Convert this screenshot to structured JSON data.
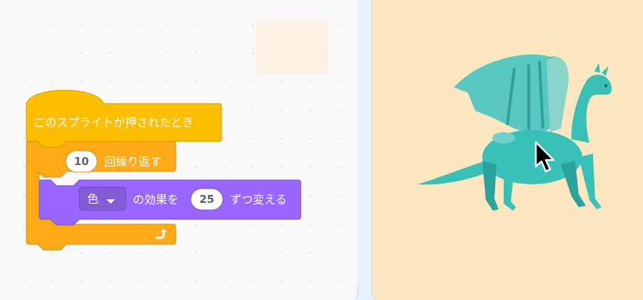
{
  "event_block": {
    "label": "このスプライトが押されたとき"
  },
  "repeat_block": {
    "times": "10",
    "label": "回繰り返す"
  },
  "effect_block": {
    "effect_selected": "色",
    "label_mid": "の効果を",
    "amount": "25",
    "label_end": "ずつ変える"
  },
  "stage": {
    "sprite": "dragon",
    "sprite_color": "#39c0b8"
  },
  "colors": {
    "events": "#ffbf00",
    "control": "#ffab19",
    "looks": "#9966ff",
    "stage_bg": "#fde7c0"
  }
}
